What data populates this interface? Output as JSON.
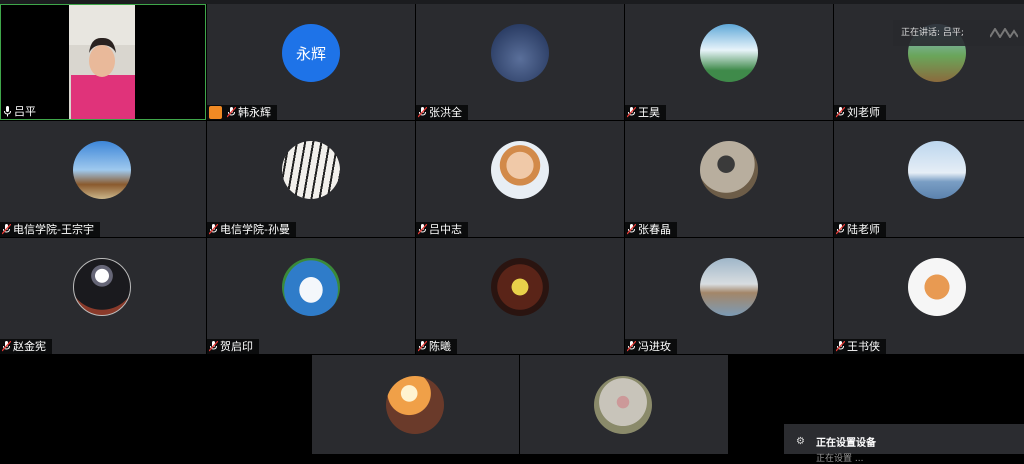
{
  "speaking_label": "正在讲话: 吕平;",
  "participants": [
    {
      "name": "吕平",
      "host": false
    },
    {
      "name": "韩永辉",
      "host": true,
      "initials": "永辉"
    },
    {
      "name": "张洪全",
      "host": false
    },
    {
      "name": "王昊",
      "host": false
    },
    {
      "name": "刘老师",
      "host": false
    },
    {
      "name": "电信学院-王宗宇",
      "host": false
    },
    {
      "name": "电信学院-孙曼",
      "host": false
    },
    {
      "name": "吕中志",
      "host": false
    },
    {
      "name": "张春晶",
      "host": false
    },
    {
      "name": "陆老师",
      "host": false
    },
    {
      "name": "赵金宪",
      "host": false
    },
    {
      "name": "贺启印",
      "host": false
    },
    {
      "name": "陈曦",
      "host": false
    },
    {
      "name": "冯进玫",
      "host": false
    },
    {
      "name": "王书侠",
      "host": false
    }
  ],
  "toast": {
    "title": "正在设置设备",
    "subtitle": "正在设置 ..."
  },
  "colors": {
    "tile_bg": "#2a2b2f",
    "active_border": "#3fa64a",
    "avatar_blue": "#1e73e8",
    "host_badge": "#f08a24"
  }
}
